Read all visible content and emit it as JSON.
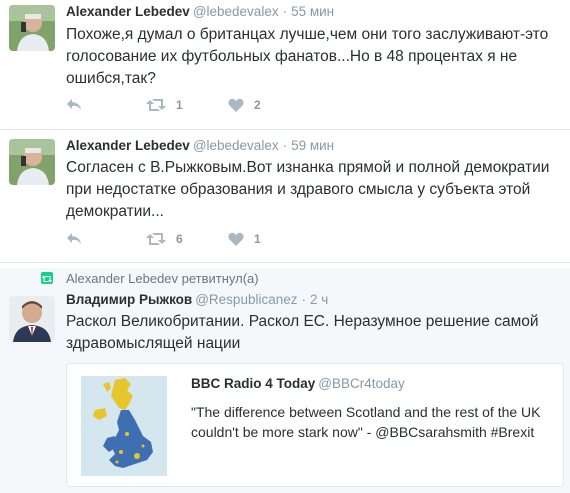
{
  "tweets": [
    {
      "name": "Alexander Lebedev",
      "handle": "@lebedevalex",
      "time": "55 мин",
      "text": "Похоже,я думал о британцах лучше,чем они того заслуживают-это голосование их футбольных фанатов...Но в 48 процентах я не ошибся,так?",
      "retweets": "1",
      "likes": "2"
    },
    {
      "name": "Alexander Lebedev",
      "handle": "@lebedevalex",
      "time": "59 мин",
      "text": "Согласен с В.Рыжковым.Вот изнанка прямой и полной демократии при недостатке образования и здравого смысла у субъекта этой демократии...",
      "retweets": "6",
      "likes": "1"
    }
  ],
  "retweet": {
    "retweeted_by": "Alexander Lebedev ретвитнул(а)",
    "name": "Владимир Рыжков",
    "handle": "@Respublicanez",
    "time": "2 ч",
    "text": "Раскол Великобритании. Раскол ЕС. Неразумное решение самой здравомыслящей нации",
    "quote": {
      "name": "BBC Radio 4 Today",
      "handle": "@BBCr4today",
      "text": "\"The difference between Scotland and the rest of the UK couldn't be more stark now\" - @BBCsarahsmith #Brexit"
    }
  },
  "icons": {
    "reply": "reply-icon",
    "retweet": "retweet-icon",
    "like": "heart-icon",
    "retweeted": "retweeted-badge-icon"
  },
  "colors": {
    "action_gray": "#aab8c2",
    "retweet_green": "#19cf86",
    "map_remain": "#e6c62a",
    "map_leave": "#3f6fb3"
  }
}
